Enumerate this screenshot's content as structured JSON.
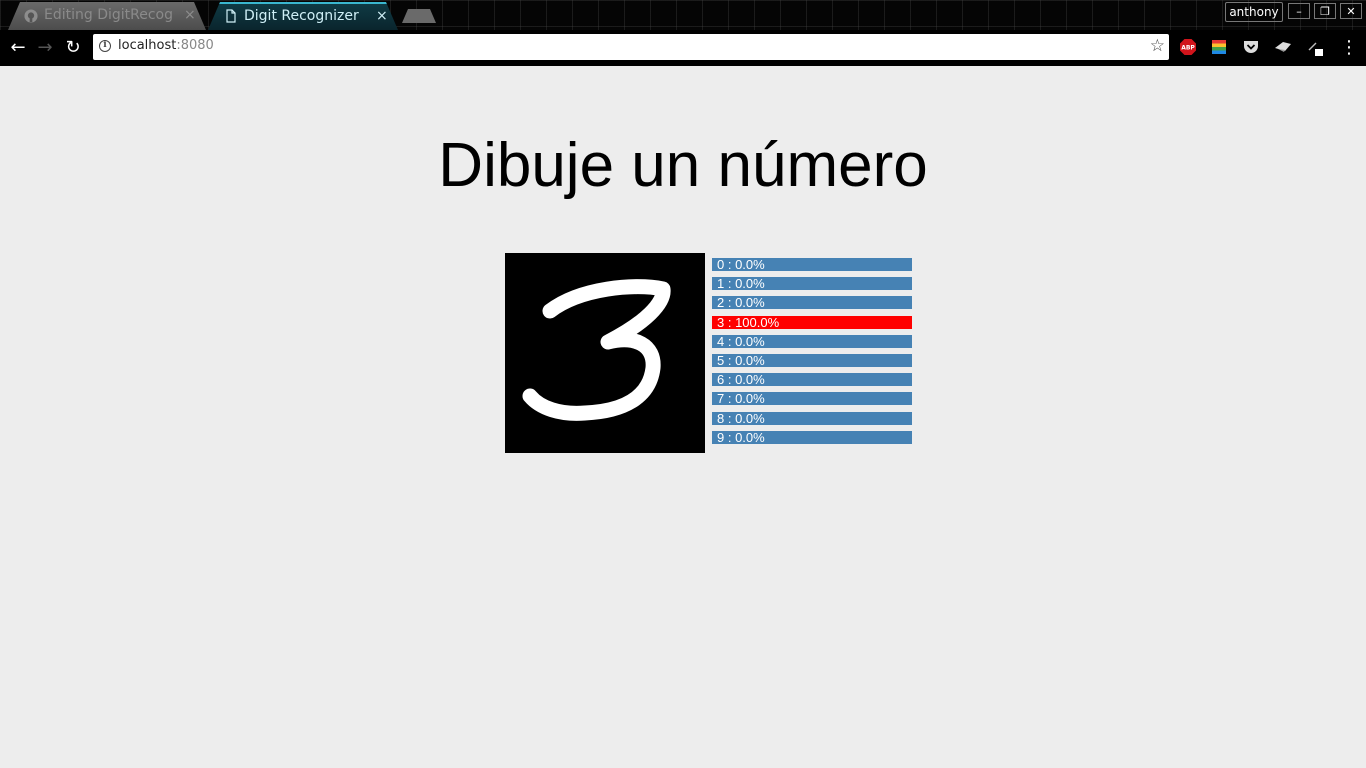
{
  "browser": {
    "tabs": [
      {
        "title": "Editing DigitRecogn",
        "icon": "github-icon",
        "active": false
      },
      {
        "title": "Digit Recognizer",
        "icon": "document-icon",
        "active": true
      }
    ],
    "tab_close_glyph": "×",
    "profile_name": "anthony",
    "window_buttons": {
      "minimize": "–",
      "maximize": "❐",
      "close": "✕"
    },
    "nav": {
      "back": "←",
      "forward": "→",
      "reload": "↻"
    },
    "url_host": "localhost",
    "url_port": ":8080",
    "bookmark_glyph": "☆",
    "menu_glyph": "⋮",
    "extensions": [
      "adblock-plus-icon",
      "color-picker-icon",
      "pocket-icon",
      "cast-icon",
      "pen-icon"
    ],
    "accent_color": "#3ab7cf"
  },
  "page": {
    "title": "Dibuje un número",
    "drawn_digit": "3",
    "predictions": [
      {
        "label": "0 : 0.0%",
        "value": 0.0
      },
      {
        "label": "1 : 0.0%",
        "value": 0.0
      },
      {
        "label": "2 : 0.0%",
        "value": 0.0
      },
      {
        "label": "3 : 100.0%",
        "value": 100.0
      },
      {
        "label": "4 : 0.0%",
        "value": 0.0
      },
      {
        "label": "5 : 0.0%",
        "value": 0.0
      },
      {
        "label": "6 : 0.0%",
        "value": 0.0
      },
      {
        "label": "7 : 0.0%",
        "value": 0.0
      },
      {
        "label": "8 : 0.0%",
        "value": 0.0
      },
      {
        "label": "9 : 0.0%",
        "value": 0.0
      }
    ],
    "colors": {
      "bar": "#4682b4",
      "top_prediction": "#ff0000",
      "canvas_bg": "#000000",
      "stroke": "#ffffff"
    }
  }
}
